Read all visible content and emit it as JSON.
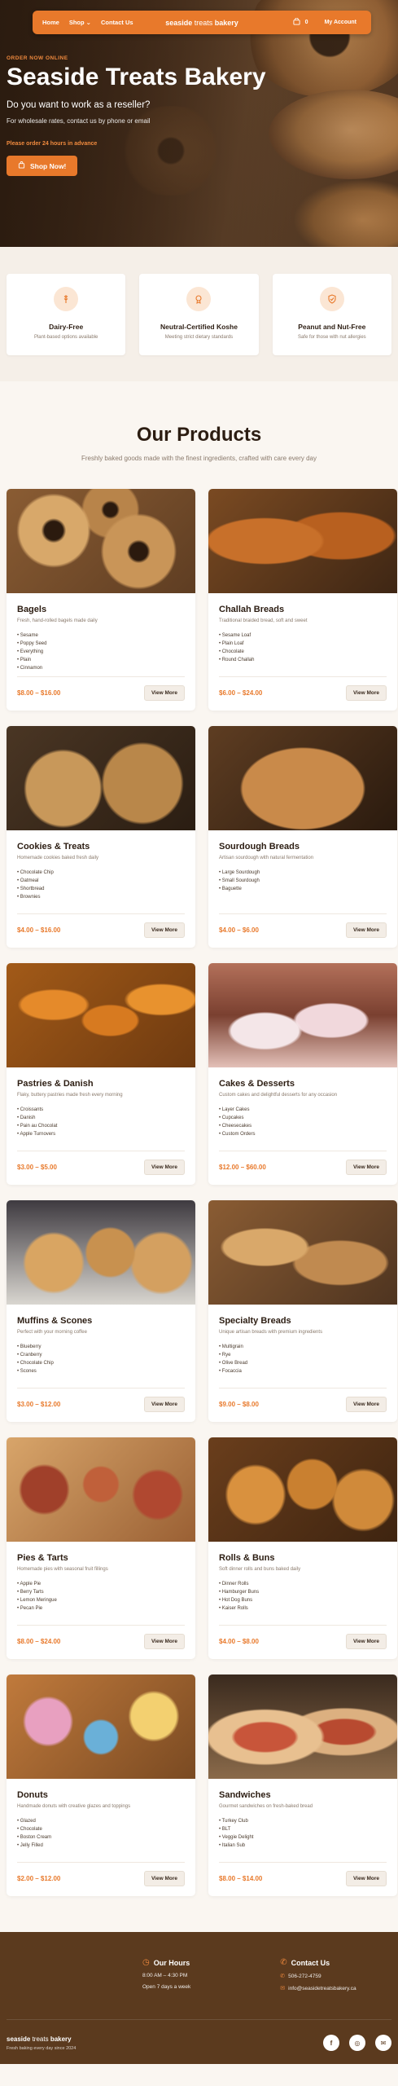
{
  "nav": {
    "links": [
      {
        "label": "Home"
      },
      {
        "label": "Shop ⌄"
      },
      {
        "label": "Contact Us"
      }
    ],
    "brand_1": "seaside ",
    "brand_2": "treats",
    "brand_3": " bakery",
    "cart_count": "0",
    "account_label": "My Account"
  },
  "hero": {
    "eyebrow": "ORDER NOW ONLINE",
    "title": "Seaside Treats Bakery",
    "question": "Do you want to work as a reseller?",
    "subtitle": "For wholesale rates, contact us by phone or email",
    "note": "Please order 24 hours in advance",
    "cta_label": "Shop Now!"
  },
  "features": [
    {
      "icon": "wheat-icon",
      "title": "Dairy-Free",
      "desc": "Plant-based options available"
    },
    {
      "icon": "certificate-icon",
      "title": "Neutral-Certified Koshe",
      "desc": "Meeting strict dietary standards"
    },
    {
      "icon": "shield-check-icon",
      "title": "Peanut and Nut-Free",
      "desc": "Safe for those with nut allergies"
    }
  ],
  "products": {
    "title": "Our Products",
    "subtitle": "Freshly baked goods made with the finest ingredients, crafted with care every day",
    "button_label": "View More",
    "items": [
      {
        "name": "Bagels",
        "desc": "Fresh, hand-rolled bagels made daily",
        "list": [
          "Sesame",
          "Poppy Seed",
          "Everything",
          "Plain",
          "Cinnamon"
        ],
        "price": "$8.00 – $16.00"
      },
      {
        "name": "Challah Breads",
        "desc": "Traditional braided bread, soft and sweet",
        "list": [
          "Sesame Loaf",
          "Plain Loaf",
          "Chocolate",
          "Round Challah"
        ],
        "price": "$6.00 – $24.00"
      },
      {
        "name": "Cookies & Treats",
        "desc": "Homemade cookies baked fresh daily",
        "list": [
          "Chocolate Chip",
          "Oatmeal",
          "Shortbread",
          "Brownies"
        ],
        "price": "$4.00 – $16.00"
      },
      {
        "name": "Sourdough Breads",
        "desc": "Artisan sourdough with natural fermentation",
        "list": [
          "Large Sourdough",
          "Small Sourdough",
          "Baguette"
        ],
        "price": "$4.00 – $6.00"
      },
      {
        "name": "Pastries & Danish",
        "desc": "Flaky, buttery pastries made fresh every morning",
        "list": [
          "Croissants",
          "Danish",
          "Pain au Chocolat",
          "Apple Turnovers"
        ],
        "price": "$3.00 – $5.00"
      },
      {
        "name": "Cakes & Desserts",
        "desc": "Custom cakes and delightful desserts for any occasion",
        "list": [
          "Layer Cakes",
          "Cupcakes",
          "Cheesecakes",
          "Custom Orders"
        ],
        "price": "$12.00 – $60.00"
      },
      {
        "name": "Muffins & Scones",
        "desc": "Perfect with your morning coffee",
        "list": [
          "Blueberry",
          "Cranberry",
          "Chocolate Chip",
          "Scones"
        ],
        "price": "$3.00 – $12.00"
      },
      {
        "name": "Specialty Breads",
        "desc": "Unique artisan breads with premium ingredients",
        "list": [
          "Multigrain",
          "Rye",
          "Olive Bread",
          "Focaccia"
        ],
        "price": "$9.00 – $8.00"
      },
      {
        "name": "Pies & Tarts",
        "desc": "Homemade pies with seasonal fruit fillings",
        "list": [
          "Apple Pie",
          "Berry Tarts",
          "Lemon Meringue",
          "Pecan Pie"
        ],
        "price": "$8.00 – $24.00"
      },
      {
        "name": "Rolls & Buns",
        "desc": "Soft dinner rolls and buns baked daily",
        "list": [
          "Dinner Rolls",
          "Hamburger Buns",
          "Hot Dog Buns",
          "Kaiser Rolls"
        ],
        "price": "$4.00 – $8.00"
      },
      {
        "name": "Donuts",
        "desc": "Handmade donuts with creative glazes and toppings",
        "list": [
          "Glazed",
          "Chocolate",
          "Boston Cream",
          "Jelly Filled"
        ],
        "price": "$2.00 – $12.00"
      },
      {
        "name": "Sandwiches",
        "desc": "Gourmet sandwiches on fresh-baked bread",
        "list": [
          "Turkey Club",
          "BLT",
          "Veggie Delight",
          "Italian Sub"
        ],
        "price": "$8.00 – $14.00"
      }
    ]
  },
  "footer": {
    "hours_title": "Our Hours",
    "hours_time": "8:00 AM – 4:30 PM",
    "hours_days": "Open 7 days a week",
    "contact_title": "Contact Us",
    "phone": "506-272-4759",
    "email": "info@seasidetreatsbakery.ca",
    "brand_1": "seaside ",
    "brand_2": "treats",
    "brand_3": " bakery",
    "tagline": "Fresh baking every day since 2024",
    "social": [
      "f",
      "◎",
      "✉"
    ]
  },
  "colors": {
    "accent": "#e8792b",
    "dark_brown": "#5b3a1e",
    "background": "#faf6f1"
  }
}
